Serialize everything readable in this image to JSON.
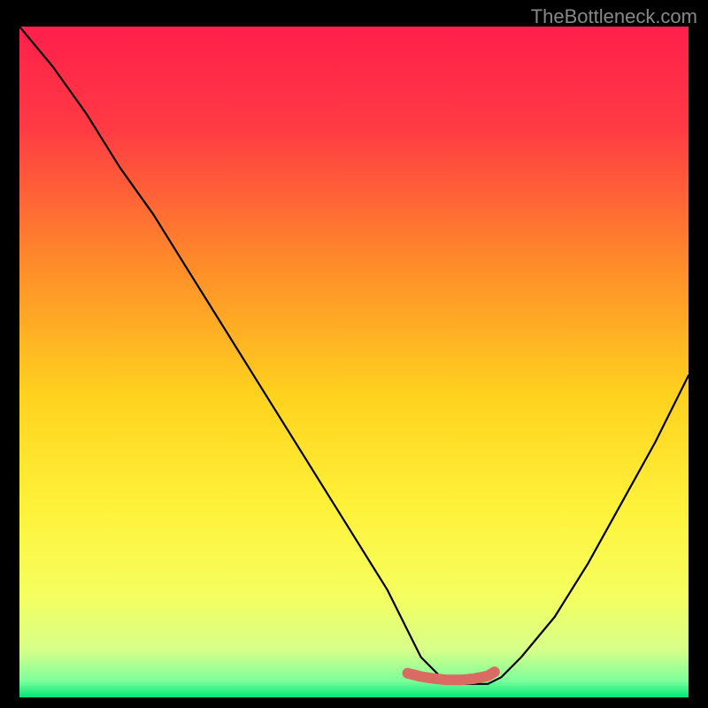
{
  "watermark": "TheBottleneck.com",
  "chart_data": {
    "type": "line",
    "title": "",
    "xlabel": "",
    "ylabel": "",
    "xlim": [
      0,
      100
    ],
    "ylim": [
      0,
      100
    ],
    "grid": false,
    "series": [
      {
        "name": "bottleneck-curve",
        "x": [
          0,
          5,
          10,
          15,
          20,
          25,
          30,
          35,
          40,
          45,
          50,
          55,
          58,
          60,
          64,
          68,
          70,
          72,
          75,
          80,
          85,
          90,
          95,
          100
        ],
        "y": [
          100,
          94,
          87,
          79,
          72,
          64,
          56,
          48,
          40,
          32,
          24,
          16,
          10,
          6,
          2,
          2,
          2,
          3,
          6,
          12,
          20,
          29,
          38,
          48
        ]
      }
    ],
    "highlight_segment": {
      "name": "optimal-range",
      "x": [
        58,
        60,
        62,
        64,
        66,
        68,
        70,
        71
      ],
      "y": [
        3.6,
        3.1,
        2.8,
        2.6,
        2.6,
        2.8,
        3.2,
        3.8
      ]
    },
    "background_gradient_stops": [
      {
        "pos": 0.0,
        "color": "#ff1f4b"
      },
      {
        "pos": 0.15,
        "color": "#ff3a44"
      },
      {
        "pos": 0.35,
        "color": "#ff8a2a"
      },
      {
        "pos": 0.55,
        "color": "#ffd21e"
      },
      {
        "pos": 0.72,
        "color": "#fff23a"
      },
      {
        "pos": 0.85,
        "color": "#f4ff60"
      },
      {
        "pos": 0.93,
        "color": "#d6ff8a"
      },
      {
        "pos": 0.975,
        "color": "#7dff9b"
      },
      {
        "pos": 1.0,
        "color": "#00e676"
      }
    ]
  }
}
